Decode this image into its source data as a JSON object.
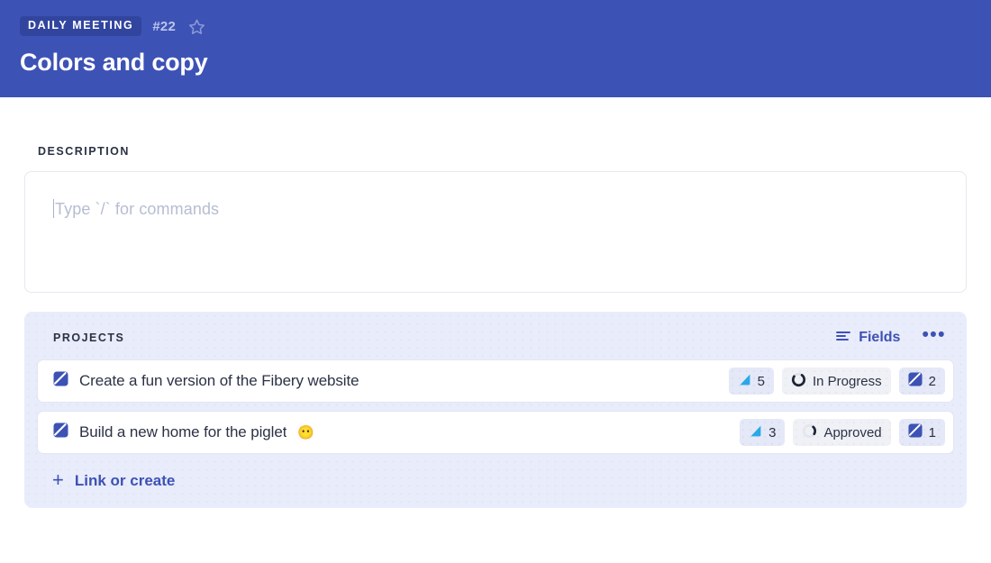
{
  "header": {
    "type_badge": "DAILY MEETING",
    "entity_number": "#22",
    "title": "Colors and copy",
    "star_icon": "star-outline-icon",
    "bg_color": "#3d52b5",
    "badge_bg_color": "#31459f"
  },
  "description": {
    "label": "DESCRIPTION",
    "placeholder": "Type `/` for commands",
    "value": ""
  },
  "projects": {
    "label": "PROJECTS",
    "fields_label": "Fields",
    "fields_icon": "filter-lines-icon",
    "more_label": "•••",
    "more_icon": "ellipsis-icon",
    "accent_color": "#3d52b5",
    "panel_bg_color": "#e9ecfa",
    "rows": [
      {
        "icon": "project-square-icon",
        "title": "Create a fun version of the Fibery website",
        "emoji": "",
        "badges": [
          {
            "icon": "triangle-priority-icon",
            "value": "5",
            "style": "lavender",
            "icon_color": "#2aa8e8"
          },
          {
            "icon": "progress-ring-icon",
            "value": "In Progress",
            "style": "gray",
            "progress": 0.75
          },
          {
            "icon": "project-square-icon",
            "value": "2",
            "style": "lavender",
            "icon_color": "#3d52b5"
          }
        ]
      },
      {
        "icon": "project-square-icon",
        "title": "Build a new home for the piglet",
        "emoji": "😶",
        "badges": [
          {
            "icon": "triangle-priority-icon",
            "value": "3",
            "style": "lavender",
            "icon_color": "#2aa8e8"
          },
          {
            "icon": "progress-ring-icon",
            "value": "Approved",
            "style": "gray",
            "progress": 0.22
          },
          {
            "icon": "project-square-icon",
            "value": "1",
            "style": "lavender",
            "icon_color": "#3d52b5"
          }
        ]
      }
    ],
    "link_or_create_label": "Link or create",
    "link_or_create_icon": "plus-icon"
  }
}
